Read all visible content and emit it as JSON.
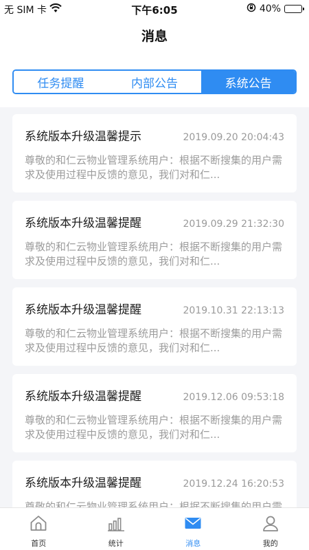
{
  "status_bar": {
    "carrier": "无 SIM 卡",
    "time": "下午6:05",
    "battery": "40%",
    "battery_level": 0.4
  },
  "header": {
    "title": "消息"
  },
  "segment_tabs": [
    {
      "label": "任务提醒",
      "active": false
    },
    {
      "label": "内部公告",
      "active": false
    },
    {
      "label": "系统公告",
      "active": true
    }
  ],
  "messages": [
    {
      "title": "系统版本升级温馨提示",
      "time": "2019.09.20 20:04:43",
      "body": "尊敬的和仁云物业管理系统用户：根据不断搜集的用户需求及使用过程中反馈的意见，我们对和仁..."
    },
    {
      "title": "系统版本升级温馨提醒",
      "time": "2019.09.29 21:32:30",
      "body": "尊敬的和仁云物业管理系统用户：根据不断搜集的用户需求及使用过程中反馈的意见，我们对和仁..."
    },
    {
      "title": "系统版本升级温馨提醒",
      "time": "2019.10.31 22:13:13",
      "body": "尊敬的和仁云物业管理系统用户：根据不断搜集的用户需求及使用过程中反馈的意见，我们对和仁..."
    },
    {
      "title": "系统版本升级温馨提醒",
      "time": "2019.12.06 09:53:18",
      "body": "尊敬的和仁云物业管理系统用户：根据不断搜集的用户需求及使用过程中反馈的意见，我们对和仁..."
    },
    {
      "title": "系统版本升级温馨提醒",
      "time": "2019.12.24 16:20:53",
      "body": "尊敬的和仁云物业管理系统用户：根据不断搜集的用户需求及使用过程中反馈的意见，我们对和仁..."
    }
  ],
  "tabbar": [
    {
      "label": "首页",
      "icon": "home-icon",
      "active": false
    },
    {
      "label": "统计",
      "icon": "chart-icon",
      "active": false
    },
    {
      "label": "消息",
      "icon": "mail-icon",
      "active": true
    },
    {
      "label": "我的",
      "icon": "user-icon",
      "active": false
    }
  ],
  "colors": {
    "accent": "#2f8cf2",
    "background": "#f4f5f8",
    "inactive_icon": "#8a8a8a"
  }
}
